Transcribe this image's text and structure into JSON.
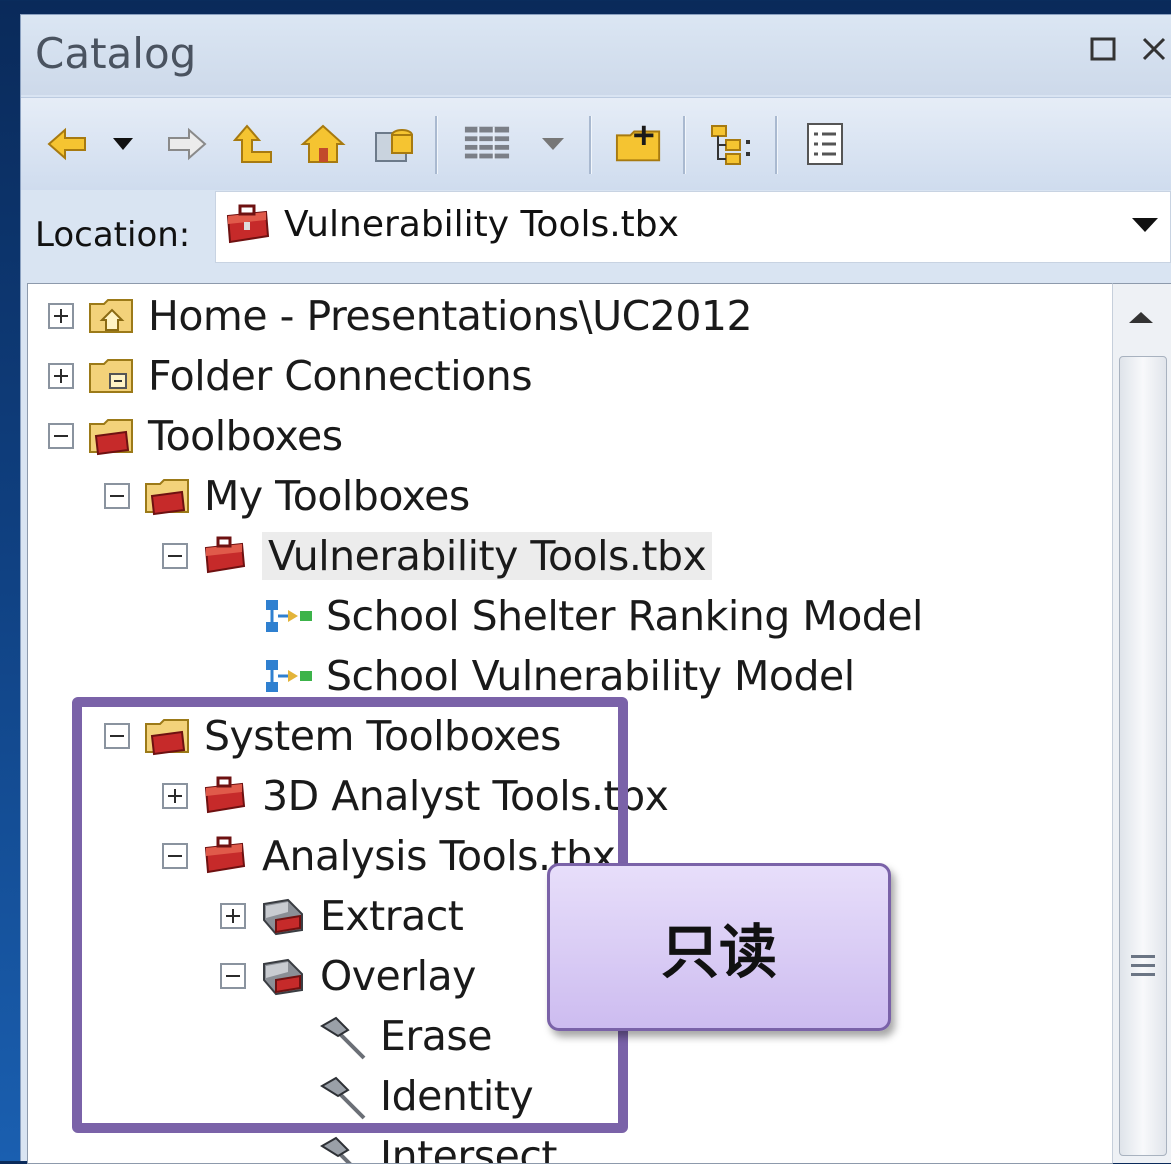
{
  "window": {
    "title": "Catalog"
  },
  "location": {
    "label": "Location:",
    "value": "Vulnerability Tools.tbx"
  },
  "tree": {
    "home": "Home - Presentations\\UC2012",
    "folder_connections": "Folder Connections",
    "toolboxes": "Toolboxes",
    "my_toolboxes": "My Toolboxes",
    "vulnerability_tools": "Vulnerability Tools.tbx",
    "model_1": "School Shelter Ranking Model",
    "model_2": "School Vulnerability Model",
    "system_toolboxes": "System Toolboxes",
    "analyst_3d": "3D Analyst Tools.tbx",
    "analysis_tools": "Analysis Tools.tbx",
    "extract": "Extract",
    "overlay": "Overlay",
    "erase": "Erase",
    "identity": "Identity",
    "intersect": "Intersect"
  },
  "callout": {
    "text": "只读"
  },
  "colors": {
    "highlight_border": "#7a62a8",
    "callout_fill": "#d9ccf5",
    "background": "#0f3f7f"
  },
  "icons": {
    "back": "back-arrow-icon",
    "forward": "forward-arrow-icon",
    "up": "up-one-level-icon",
    "home": "home-icon",
    "connect": "connect-folder-icon",
    "view": "view-list-icon",
    "new_folder": "new-folder-icon",
    "tree_toggle": "toggle-tree-icon",
    "options": "options-icon"
  }
}
